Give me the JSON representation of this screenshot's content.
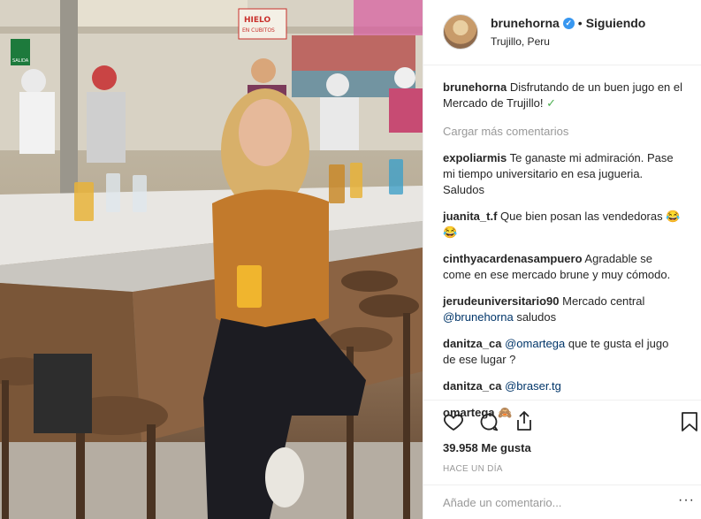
{
  "post": {
    "username": "brunehorna",
    "separator": "•",
    "follow_label": "Siguiendo",
    "location": "Trujillo, Peru"
  },
  "photo_signs": {
    "sign_hielo": "HIELO\nEN CUBITOS",
    "sign_exit": "SALIDA"
  },
  "caption": {
    "username": "brunehorna",
    "text": "Disfrutando de un buen jugo en el Mercado de Trujillo!",
    "check": "✓"
  },
  "load_more": "Cargar más comentarios",
  "comments": [
    {
      "username": "expoliarmis",
      "text": "Te ganaste mi admiración. Pase mi tiempo universitario en esa jugueria. Saludos"
    },
    {
      "username": "juanita_t.f",
      "text": "Que bien posan las vendedoras 😂😂"
    },
    {
      "username": "cinthyacardenasampuero",
      "text": "Agradable se come en ese mercado brune y muy cómodo."
    },
    {
      "username": "jerudeuniversitario90",
      "text": "Mercado central",
      "mention": "@brunehorna",
      "after": " saludos"
    },
    {
      "username": "danitza_ca",
      "mention": "@omartega",
      "after": " que te gusta el jugo de ese lugar ?"
    },
    {
      "username": "danitza_ca",
      "mention": "@braser.tg",
      "after": ""
    },
    {
      "username": "omartega",
      "text": "🙈"
    }
  ],
  "likes": "39.958 Me gusta",
  "time": "HACE UN DÍA",
  "add_comment_placeholder": "Añade un comentario...",
  "more_label": "···",
  "icons": {
    "like": "heart-icon",
    "comment": "comment-icon",
    "share": "share-icon",
    "save": "bookmark-icon"
  }
}
